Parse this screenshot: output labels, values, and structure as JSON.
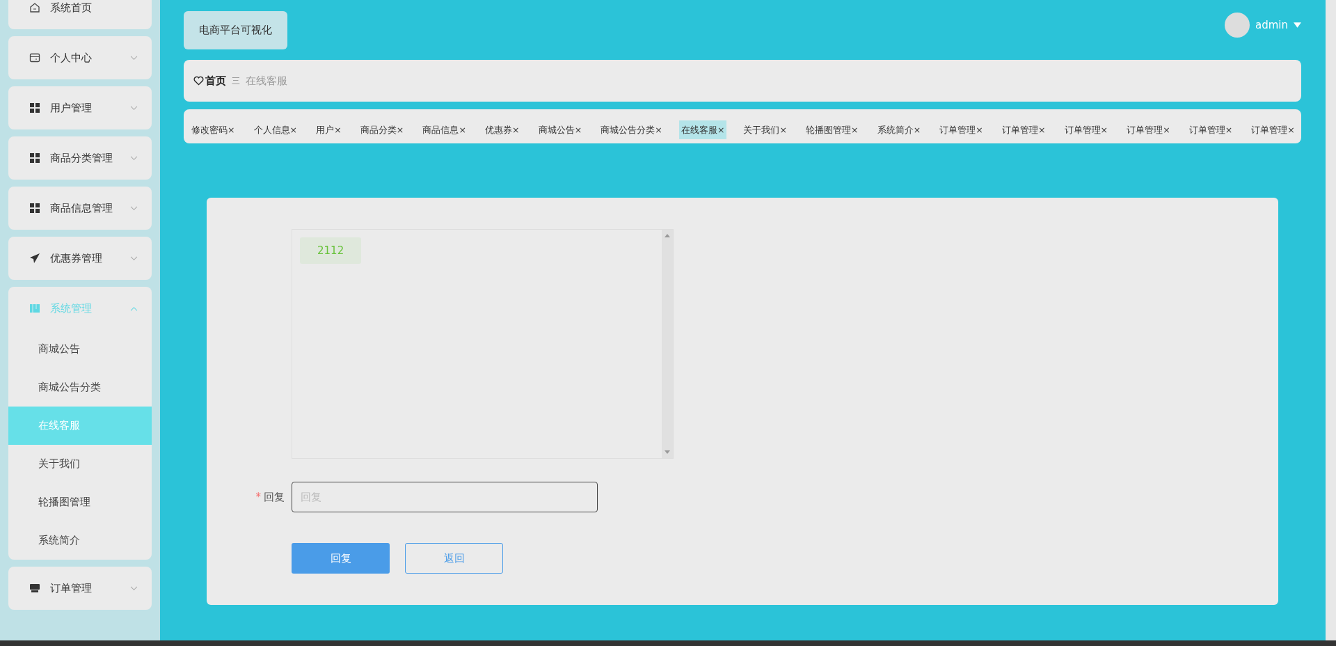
{
  "sidebar": {
    "items": [
      {
        "label": "系统首页",
        "kind": "home"
      },
      {
        "label": "个人中心",
        "kind": "card",
        "expanded": false
      },
      {
        "label": "用户管理",
        "kind": "grid",
        "expanded": false
      },
      {
        "label": "商品分类管理",
        "kind": "grid",
        "expanded": false
      },
      {
        "label": "商品信息管理",
        "kind": "grid",
        "expanded": false
      },
      {
        "label": "优惠券管理",
        "kind": "plane",
        "expanded": false
      },
      {
        "label": "系统管理",
        "kind": "book",
        "expanded": true,
        "children": [
          {
            "label": "商城公告",
            "selected": false
          },
          {
            "label": "商城公告分类",
            "selected": false
          },
          {
            "label": "在线客服",
            "selected": true
          },
          {
            "label": "关于我们",
            "selected": false
          },
          {
            "label": "轮播图管理",
            "selected": false
          },
          {
            "label": "系统简介",
            "selected": false
          }
        ]
      },
      {
        "label": "订单管理",
        "kind": "store",
        "expanded": false
      }
    ]
  },
  "header": {
    "title": "电商平台可视化",
    "user": "admin"
  },
  "breadcrumb": {
    "home": "首页",
    "separator": "三",
    "current": "在线客服"
  },
  "tabs": [
    {
      "label": "修改密码",
      "close": "×",
      "selected": false
    },
    {
      "label": "个人信息",
      "close": "×",
      "selected": false
    },
    {
      "label": "用户",
      "close": "×",
      "selected": false
    },
    {
      "label": "商品分类",
      "close": "×",
      "selected": false
    },
    {
      "label": "商品信息",
      "close": "×",
      "selected": false
    },
    {
      "label": "优惠券",
      "close": "×",
      "selected": false
    },
    {
      "label": "商城公告",
      "close": "×",
      "selected": false
    },
    {
      "label": "商城公告分类",
      "close": "×",
      "selected": false
    },
    {
      "label": "在线客服",
      "close": "×",
      "selected": true
    },
    {
      "label": "关于我们",
      "close": "×",
      "selected": false
    },
    {
      "label": "轮播图管理",
      "close": "×",
      "selected": false
    },
    {
      "label": "系统简介",
      "close": "×",
      "selected": false
    },
    {
      "label": "订单管理",
      "close": "×",
      "selected": false
    },
    {
      "label": "订单管理",
      "close": "×",
      "selected": false
    },
    {
      "label": "订单管理",
      "close": "×",
      "selected": false
    },
    {
      "label": "订单管理",
      "close": "×",
      "selected": false
    },
    {
      "label": "订单管理",
      "close": "×",
      "selected": false
    },
    {
      "label": "订单管理",
      "close": "×",
      "selected": false
    }
  ],
  "chat": {
    "messages": [
      "2112"
    ]
  },
  "form": {
    "required_mark": "*",
    "label": "回复",
    "placeholder": "回复",
    "buttons": [
      {
        "label": "回复",
        "kind": "primary"
      },
      {
        "label": "返回",
        "kind": "plain"
      }
    ]
  }
}
